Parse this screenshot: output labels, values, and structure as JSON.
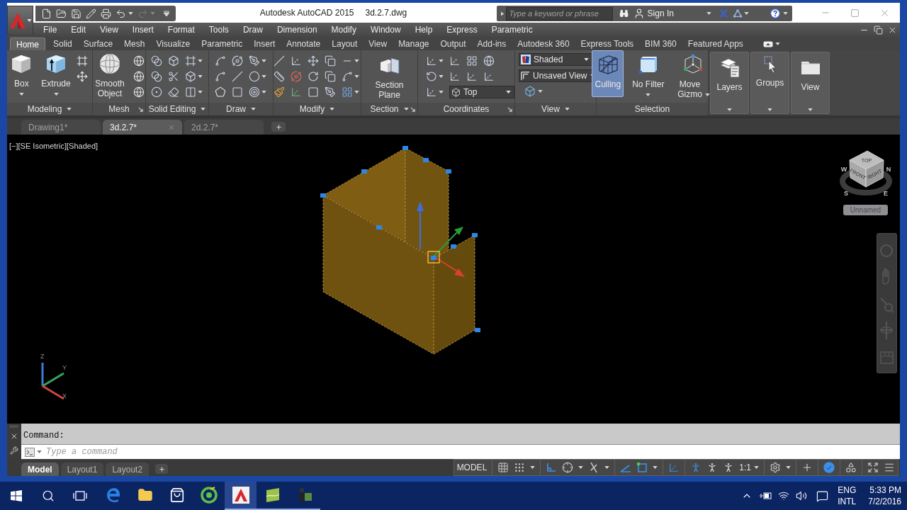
{
  "title_bar": {
    "quick_access": [
      {
        "kind": "new",
        "disabled": false
      },
      {
        "kind": "open",
        "disabled": false
      },
      {
        "kind": "save",
        "disabled": false
      },
      {
        "kind": "save_as",
        "disabled": false
      },
      {
        "kind": "print",
        "disabled": false
      },
      {
        "kind": "undo",
        "disabled": false
      },
      {
        "kind": "redo",
        "disabled": true
      }
    ],
    "app_title": "Autodesk AutoCAD 2015",
    "file_name": "3d.2.7.dwg",
    "search": {
      "placeholder": "Type a keyword or phrase"
    },
    "sign_in": "Sign In"
  },
  "menu_bar": [
    "File",
    "Edit",
    "View",
    "Insert",
    "Format",
    "Tools",
    "Draw",
    "Dimension",
    "Modify",
    "Window",
    "Help",
    "Express",
    "Parametric"
  ],
  "ribbon": {
    "tabs": [
      {
        "label": "Home",
        "selected": true
      },
      {
        "label": "Solid",
        "selected": false
      },
      {
        "label": "Surface",
        "selected": false
      },
      {
        "label": "Mesh",
        "selected": false
      },
      {
        "label": "Visualize",
        "selected": false
      },
      {
        "label": "Parametric",
        "selected": false
      },
      {
        "label": "Insert",
        "selected": false
      },
      {
        "label": "Annotate",
        "selected": false
      },
      {
        "label": "Layout",
        "selected": false
      },
      {
        "label": "View",
        "selected": false
      },
      {
        "label": "Manage",
        "selected": false
      },
      {
        "label": "Output",
        "selected": false
      },
      {
        "label": "Add-ins",
        "selected": false
      },
      {
        "label": "Autodesk 360",
        "selected": false
      },
      {
        "label": "Express Tools",
        "selected": false
      },
      {
        "label": "BIM 360",
        "selected": false
      },
      {
        "label": "Featured Apps",
        "selected": false
      }
    ],
    "modeling": {
      "title": "Modeling",
      "tools": [
        "Box",
        "Extrude"
      ]
    },
    "mesh": {
      "title": "Mesh",
      "tool": "Smooth Object"
    },
    "solid_editing": {
      "title": "Solid Editing"
    },
    "draw": {
      "title": "Draw"
    },
    "modify": {
      "title": "Modify"
    },
    "section": {
      "title": "Section",
      "tool": "Section Plane"
    },
    "coordinates": {
      "title": "Coordinates",
      "ucs_view": "Top"
    },
    "view": {
      "title": "View",
      "visual_style": "Shaded",
      "named_view": "Unsaved View"
    },
    "selection": {
      "title": "Selection",
      "tools": [
        {
          "label": "Culling",
          "on": true
        },
        {
          "label": "No Filter",
          "on": false
        },
        {
          "label": "Move Gizmo",
          "on": false
        }
      ]
    },
    "layers": {
      "label": "Layers"
    },
    "groups": {
      "label": "Groups"
    },
    "view_2": {
      "label": "View"
    }
  },
  "file_tabs": [
    {
      "label": "Drawing1*",
      "selected": false
    },
    {
      "label": "3d.2.7*",
      "selected": true
    },
    {
      "label": "2d.2.7*",
      "selected": false
    }
  ],
  "viewport": {
    "controls": [
      "[−]",
      "[SE Isometric]",
      "[Shaded]"
    ],
    "view_cube": {
      "faces": [
        "TOP",
        "FRONT",
        "RIGHT"
      ],
      "compass": [
        "W",
        "N",
        "S",
        "E"
      ],
      "label": "Unnamed"
    },
    "ucs_axes": [
      "Z",
      "Y",
      "X"
    ]
  },
  "command_line": {
    "history": "Command:",
    "input": {
      "placeholder": "Type a command"
    }
  },
  "layout_tabs": [
    {
      "label": "Model",
      "selected": true
    },
    {
      "label": "Layout1",
      "selected": false
    },
    {
      "label": "Layout2",
      "selected": false
    }
  ],
  "status_bar": {
    "model": "MODEL",
    "toggles": [
      {
        "kind": "grid",
        "on": false
      },
      {
        "kind": "snap",
        "on": false
      },
      {
        "kind": "ortho",
        "on": true
      },
      {
        "kind": "polar",
        "on": false
      },
      {
        "kind": "isodraft",
        "on": false
      },
      {
        "kind": "tracking",
        "on": true
      },
      {
        "kind": "osnap",
        "on": true
      },
      {
        "kind": "ucs",
        "on": true
      },
      {
        "kind": "annotation",
        "on": true
      },
      {
        "kind": "annotation",
        "on": false
      },
      {
        "kind": "annotation",
        "on": false
      },
      {
        "kind": "hardware",
        "on": true
      }
    ],
    "scale": "1:1"
  },
  "taskbar": {
    "apps": [
      {
        "kind": "edge",
        "running": false,
        "active": false
      },
      {
        "kind": "explorer",
        "running": false,
        "active": false
      },
      {
        "kind": "store",
        "running": false,
        "active": false
      },
      {
        "kind": "ring",
        "running": false,
        "active": false
      },
      {
        "kind": "autocad",
        "running": true,
        "active": true
      },
      {
        "kind": "tile",
        "running": true,
        "active": false
      },
      {
        "kind": "media",
        "running": true,
        "active": false
      }
    ],
    "tray": {
      "language": "ENG",
      "layout": "INTL",
      "time": "5:33 PM",
      "date": "7/2/2016"
    }
  }
}
